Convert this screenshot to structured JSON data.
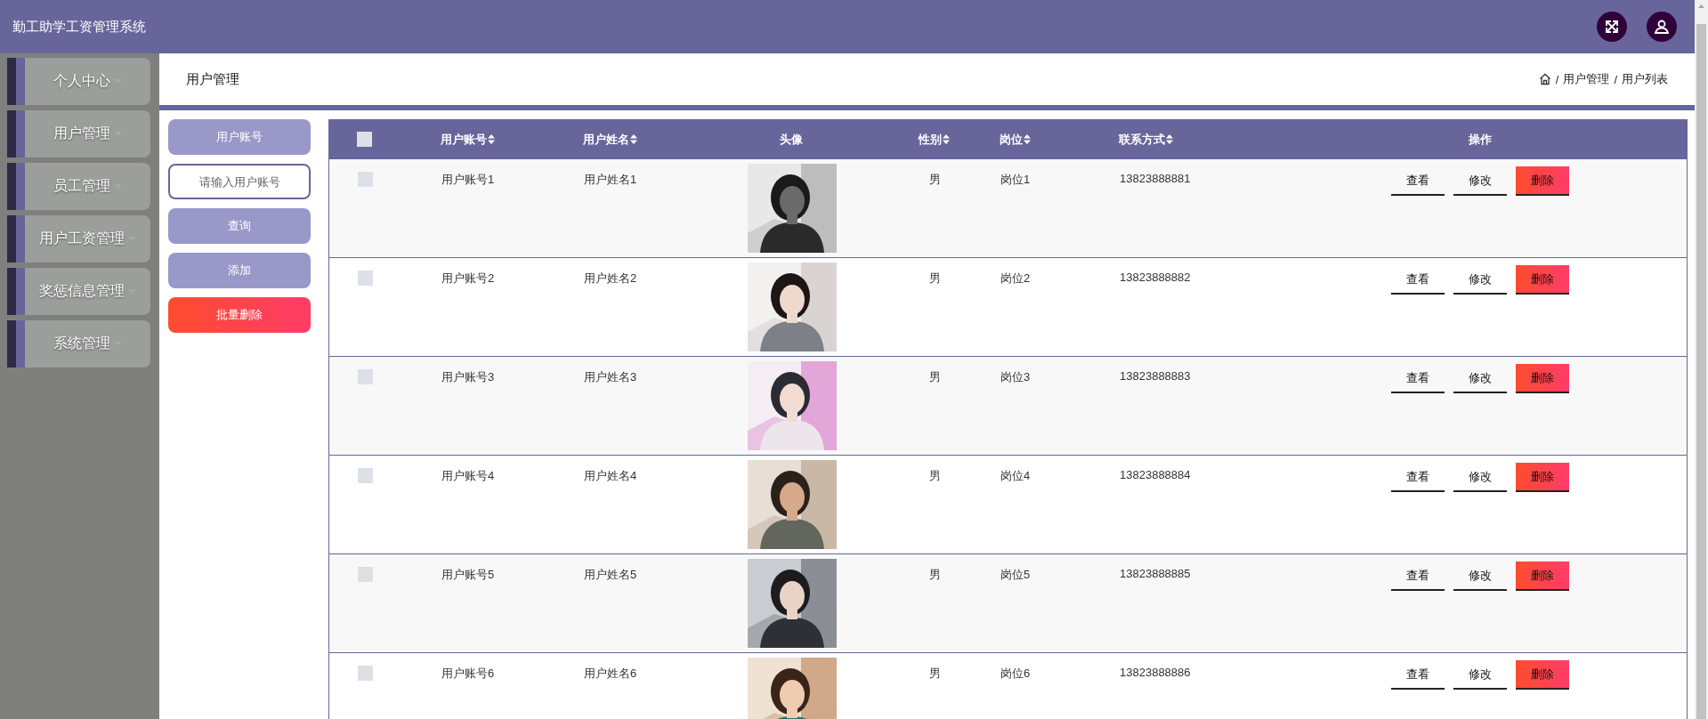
{
  "header": {
    "title": "勤工助学工资管理系统"
  },
  "sidebar": {
    "items": [
      {
        "label": "个人中心"
      },
      {
        "label": "用户管理"
      },
      {
        "label": "员工管理"
      },
      {
        "label": "用户工资管理"
      },
      {
        "label": "奖惩信息管理"
      },
      {
        "label": "系统管理"
      }
    ]
  },
  "page_title": "用户管理",
  "breadcrumb": {
    "separator": "/",
    "items": [
      "用户管理",
      "用户列表"
    ]
  },
  "search": {
    "label": "用户账号",
    "placeholder": "请输入用户账号",
    "buttons": [
      {
        "label": "查询",
        "kind": "primary"
      },
      {
        "label": "添加",
        "kind": "primary"
      },
      {
        "label": "批量删除",
        "kind": "danger"
      }
    ]
  },
  "table": {
    "select_all": {
      "checked": false
    },
    "columns": [
      {
        "label": "用户账号",
        "sortable": true
      },
      {
        "label": "用户姓名",
        "sortable": true
      },
      {
        "label": "头像",
        "sortable": false
      },
      {
        "label": "性别",
        "sortable": true
      },
      {
        "label": "岗位",
        "sortable": true
      },
      {
        "label": "联系方式",
        "sortable": true
      },
      {
        "label": "操作",
        "sortable": false
      }
    ],
    "rows": [
      {
        "checked": false,
        "account": "用户账号1",
        "name": "用户姓名1",
        "gender": "男",
        "post": "岗位1",
        "phone": "13823888881",
        "actions": [
          {
            "label": "查看",
            "kind": "view"
          },
          {
            "label": "修改",
            "kind": "edit"
          },
          {
            "label": "删除",
            "kind": "delete"
          }
        ]
      },
      {
        "checked": false,
        "account": "用户账号2",
        "name": "用户姓名2",
        "gender": "男",
        "post": "岗位2",
        "phone": "13823888882",
        "actions": [
          {
            "label": "查看",
            "kind": "view"
          },
          {
            "label": "修改",
            "kind": "edit"
          },
          {
            "label": "删除",
            "kind": "delete"
          }
        ]
      },
      {
        "checked": false,
        "account": "用户账号3",
        "name": "用户姓名3",
        "gender": "男",
        "post": "岗位3",
        "phone": "13823888883",
        "actions": [
          {
            "label": "查看",
            "kind": "view"
          },
          {
            "label": "修改",
            "kind": "edit"
          },
          {
            "label": "删除",
            "kind": "delete"
          }
        ]
      },
      {
        "checked": false,
        "account": "用户账号4",
        "name": "用户姓名4",
        "gender": "男",
        "post": "岗位4",
        "phone": "13823888884",
        "actions": [
          {
            "label": "查看",
            "kind": "view"
          },
          {
            "label": "修改",
            "kind": "edit"
          },
          {
            "label": "删除",
            "kind": "delete"
          }
        ]
      },
      {
        "checked": false,
        "account": "用户账号5",
        "name": "用户姓名5",
        "gender": "男",
        "post": "岗位5",
        "phone": "13823888885",
        "actions": [
          {
            "label": "查看",
            "kind": "view"
          },
          {
            "label": "修改",
            "kind": "edit"
          },
          {
            "label": "删除",
            "kind": "delete"
          }
        ]
      },
      {
        "checked": false,
        "account": "用户账号6",
        "name": "用户姓名6",
        "gender": "男",
        "post": "岗位6",
        "phone": "13823888886",
        "actions": [
          {
            "label": "查看",
            "kind": "view"
          },
          {
            "label": "修改",
            "kind": "edit"
          },
          {
            "label": "删除",
            "kind": "delete"
          }
        ]
      }
    ]
  }
}
